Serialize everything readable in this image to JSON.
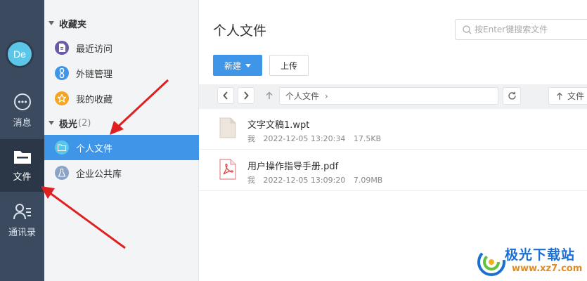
{
  "rail": {
    "avatar_text": "De",
    "items": [
      {
        "label": "消息",
        "icon": "chat-bubble-icon"
      },
      {
        "label": "文件",
        "icon": "folder-icon"
      },
      {
        "label": "通讯录",
        "icon": "contacts-icon"
      }
    ]
  },
  "sidebar": {
    "favorites_group": "收藏夹",
    "favorites": [
      {
        "label": "最近访问",
        "icon": "recent-doc-icon",
        "color": "#6b5aa8"
      },
      {
        "label": "外链管理",
        "icon": "link-icon",
        "color": "#3f95e8"
      },
      {
        "label": "我的收藏",
        "icon": "star-icon",
        "color": "#f5a623"
      }
    ],
    "team_group": "极光",
    "team_count": "(2)",
    "team_items": [
      {
        "label": "个人文件",
        "icon": "folder-icon",
        "color": "#5bc6e8"
      },
      {
        "label": "企业公共库",
        "icon": "flask-icon",
        "color": "#8aa4c8"
      }
    ]
  },
  "main": {
    "title": "个人文件",
    "search_placeholder": "按Enter键搜索文件",
    "new_button": "新建",
    "upload_button": "上传",
    "path": "个人文件",
    "path_sep": "›",
    "sort_label": "文件",
    "files": [
      {
        "name": "文字文稿1.wpt",
        "owner": "我",
        "time": "2022-12-05 13:20:34",
        "size": "17.5KB",
        "icon": "document-icon"
      },
      {
        "name": "用户操作指导手册.pdf",
        "owner": "我",
        "time": "2022-12-05 13:09:20",
        "size": "7.09MB",
        "icon": "pdf-icon"
      }
    ]
  },
  "watermark": {
    "title": "极光下载站",
    "url": "www.xz7.com"
  },
  "colors": {
    "rail": "#3b4a5e",
    "accent": "#3f95e8",
    "arrow": "#e02020"
  }
}
